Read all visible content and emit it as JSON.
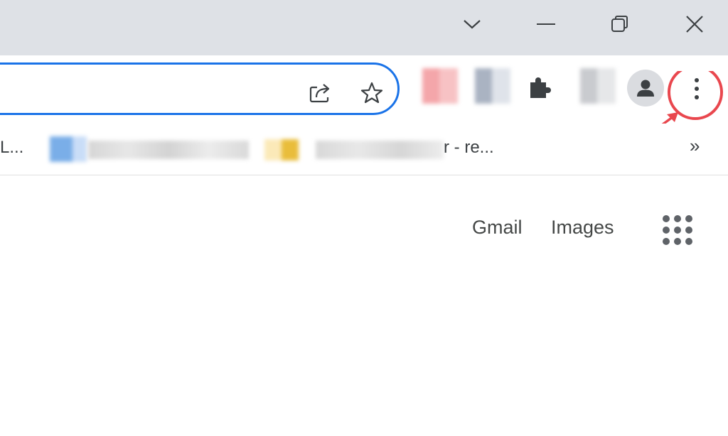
{
  "window_controls": {
    "tab_search_icon": "chevron-down-icon",
    "minimize_icon": "minimize-icon",
    "restore_icon": "restore-icon",
    "close_icon": "close-icon"
  },
  "omnibox": {
    "accent_color": "#1a73e8",
    "share_icon": "share-icon",
    "bookmark_icon": "star-icon"
  },
  "toolbar": {
    "extensions_icon": "puzzle-icon",
    "profile_icon": "person-icon",
    "menu_icon": "kebab-menu-icon",
    "highlight_color": "#e9474e"
  },
  "bookmarks_bar": {
    "item1_label": "L...",
    "item3_label": "r - re...",
    "overflow_label": "»"
  },
  "page": {
    "gmail_link": "Gmail",
    "images_link": "Images",
    "apps_icon": "apps-grid-icon"
  }
}
